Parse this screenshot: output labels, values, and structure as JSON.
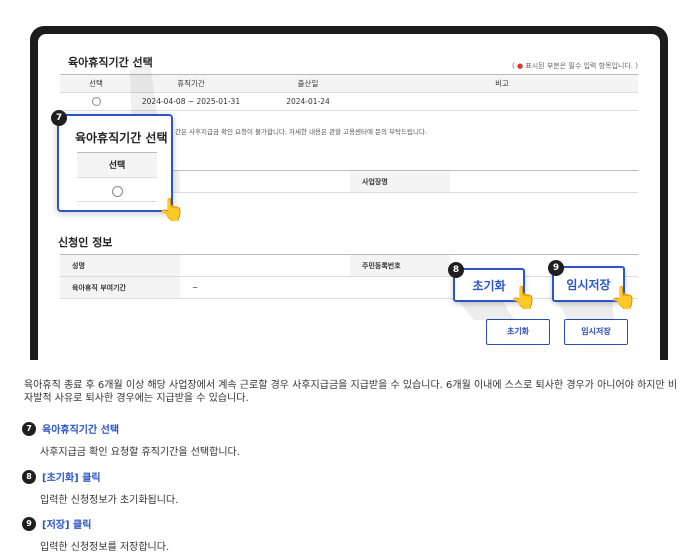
{
  "leave_section": {
    "title": "육아휴직기간 선택",
    "required_note_dot": "●",
    "required_note": "표시된 부분은 필수 입력 항목입니다.",
    "headers": [
      "선택",
      "휴직기간",
      "출산일",
      "비고"
    ],
    "row": {
      "period": "2024-04-08 ~ 2025-01-31",
      "birth_date": "2024-01-24",
      "note": ""
    },
    "notice": "간은 사후지급금 확인 요청이 불가합니다. 자세한 내용은 관할 고용센터에 문의 부탁드립니다."
  },
  "workplace_table": {
    "label": "사업장명"
  },
  "applicant_section": {
    "title": "신청인 정보",
    "rows": [
      {
        "label1": "성명",
        "value1": "",
        "label2": "주민등록번호",
        "value2": ""
      },
      {
        "label1": "육아휴직 부여기간",
        "value1": "~",
        "label2": "",
        "value2": ""
      }
    ]
  },
  "buttons": {
    "reset": "초기화",
    "temp_save": "임시저장"
  },
  "callouts": {
    "c7": {
      "badge": "7",
      "title": "육아휴직기간 선택",
      "col": "선택"
    },
    "c8": {
      "badge": "8",
      "label": "초기화"
    },
    "c9": {
      "badge": "9",
      "label": "임시저장"
    }
  },
  "instructions": {
    "intro": "육아휴직 종료 후 6개월 이상 해당 사업장에서 계속 근로할 경우 사후지급금을 지급받을 수 있습니다. 6개월 이내에 스스로 퇴사한 경우가 아니어야 하지만 비자발적 사유로 퇴사한 경우에는 지급받을 수 있습니다.",
    "steps": [
      {
        "num": "7",
        "title": "육아휴직기간 선택",
        "body": "사후지급금 확인 요청할 휴직기간을 선택합니다."
      },
      {
        "num": "8",
        "title": "[초기화] 클릭",
        "body": "입력한 신청정보가 초기화됩니다."
      },
      {
        "num": "9",
        "title": "[저장] 클릭",
        "body": "입력한 신청정보를 저장합니다."
      }
    ]
  },
  "colors": {
    "accent": "#2b56c8",
    "badge": "#1f1f1f",
    "required": "#e0322f",
    "frame": "#1c1c1c"
  },
  "icons": [
    "pointing-hand-icon",
    "radio-icon",
    "step-badge-icon"
  ]
}
